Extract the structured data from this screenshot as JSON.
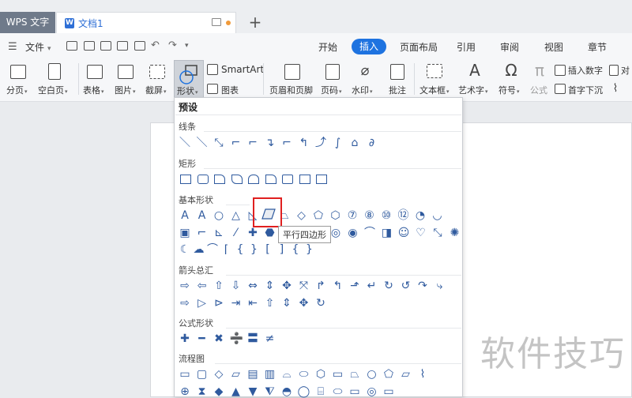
{
  "titlebar": {
    "app_tab": "WPS 文字",
    "doc_tab": "文档1",
    "doc_icon": "W",
    "new_tab": "+"
  },
  "menu": {
    "file": "文件",
    "tabs": [
      "开始",
      "插入",
      "页面布局",
      "引用",
      "审阅",
      "视图",
      "章节"
    ],
    "active_tab": "插入"
  },
  "toolbar": {
    "page_break": "分页",
    "blank_page": "空白页",
    "table": "表格",
    "picture": "图片",
    "screenshot": "截屏",
    "shape": "形状",
    "smartart": "SmartArt",
    "chart": "图表",
    "header_footer": "页眉和页脚",
    "page_number": "页码",
    "watermark": "水印",
    "comment": "批注",
    "textbox": "文本框",
    "wordart": "艺术字",
    "symbol": "符号",
    "formula": "公式",
    "insert_number": "插入数字",
    "drop_cap": "首字下沉",
    "object_partial": "对",
    "attach_icon": "paperclip-icon"
  },
  "dropdown": {
    "title": "预设",
    "sections": {
      "lines": "线条",
      "rectangles": "矩形",
      "basic": "基本形状",
      "arrows": "箭头总汇",
      "formula": "公式形状",
      "flowchart": "流程图"
    },
    "tooltip": "平行四边形",
    "glyphs": {
      "lines": [
        "＼",
        "＼",
        "⤡",
        "⌐",
        "⌐",
        "↴",
        "⌐",
        "↰",
        "⤴",
        "∫",
        "⌂",
        "∂"
      ],
      "basic_row1_a": [
        "A",
        "A",
        "○",
        "△",
        "◺"
      ],
      "basic_row1_b": [
        "⏢",
        "◇",
        "⬠",
        "⬡",
        "⑦",
        "⑧",
        "⑩",
        "⑫",
        "◔",
        "◡"
      ],
      "basic_row2": [
        "▣",
        "⌐",
        "⊾",
        "⁄",
        "✚",
        "⬣",
        "◎",
        "◉",
        "⌒",
        "◨",
        "☺",
        "♡",
        "⤡",
        "✺"
      ],
      "basic_row3": [
        "☾",
        "☁",
        "⌒",
        "⌈",
        "{",
        "}",
        "[",
        "]",
        "{",
        "}"
      ],
      "arrows_row1": [
        "⇨",
        "⇦",
        "⇧",
        "⇩",
        "⇔",
        "⇕",
        "✥",
        "⤧",
        "↱",
        "↰",
        "⬏",
        "↵",
        "↻",
        "↺",
        "↷",
        "⤷"
      ],
      "arrows_row2": [
        "⇨",
        "▷",
        "⊳",
        "⇥",
        "⇤",
        "⇧",
        "⇕",
        "✥",
        "↻"
      ],
      "formula": [
        "✚",
        "━",
        "✖",
        "➗",
        "〓",
        "≠"
      ],
      "flow_row1": [
        "▭",
        "▢",
        "◇",
        "▱",
        "▤",
        "▥",
        "⌓",
        "⬭",
        "⬡",
        "▭",
        "⏢",
        "○",
        "⬠",
        "▱",
        "⌇"
      ],
      "flow_row2": [
        "⊕",
        "⧗",
        "◆",
        "▲",
        "▼",
        "⧨",
        "◓",
        "◯",
        "⌸",
        "⬭",
        "▭",
        "◎",
        "▭"
      ]
    }
  },
  "watermark": "软件技巧"
}
